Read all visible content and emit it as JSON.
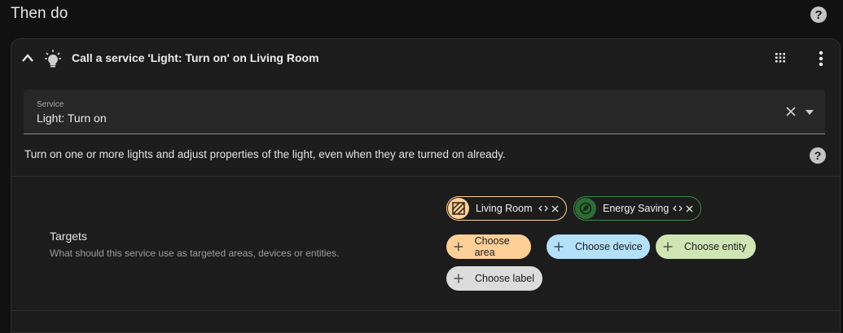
{
  "section": {
    "title": "Then do",
    "help_icon": "?"
  },
  "action": {
    "title": "Call a service 'Light: Turn on' on Living Room",
    "icon": "lightbulb-icon"
  },
  "service": {
    "label": "Service",
    "value": "Light: Turn on"
  },
  "description": "Turn on one or more lights and adjust properties of the light, even when they are turned on already.",
  "targets": {
    "title": "Targets",
    "subtitle": "What should this service use as targeted areas, devices or entities.",
    "selected": [
      {
        "label": "Living Room",
        "type": "area",
        "icon": "area-texture-icon",
        "color": "#ffcf98"
      },
      {
        "label": "Energy Saving",
        "type": "entity",
        "icon": "leaf-icon",
        "color": "#2e6b35"
      }
    ],
    "add_buttons": {
      "area": "Choose area",
      "device": "Choose device",
      "entity": "Choose entity",
      "label": "Choose label"
    }
  },
  "colors": {
    "background": "#111111",
    "card": "#1c1c1c",
    "area": "#ffcf98",
    "device": "#b5e0fc",
    "entity": "#cfe6b4",
    "label": "#dcdcdc"
  }
}
